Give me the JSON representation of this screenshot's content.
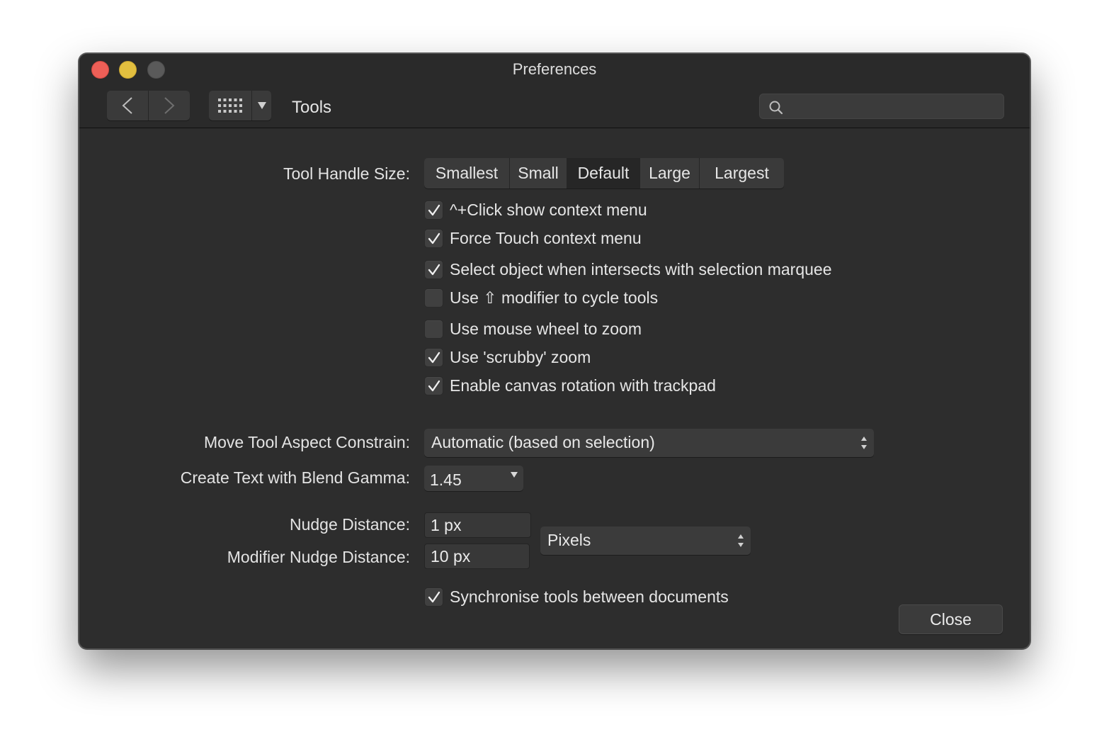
{
  "window": {
    "title": "Preferences"
  },
  "toolbar": {
    "section_title": "Tools",
    "search_placeholder": ""
  },
  "tool_handle_size": {
    "label": "Tool Handle Size:",
    "options": [
      "Smallest",
      "Small",
      "Default",
      "Large",
      "Largest"
    ],
    "selected": "Default"
  },
  "checkboxes": [
    {
      "label": "^+Click show context menu",
      "checked": true
    },
    {
      "label": "Force Touch context menu",
      "checked": true
    },
    {
      "label": "Select object when intersects with selection marquee",
      "checked": true
    },
    {
      "label": "Use ⇧ modifier to cycle tools",
      "checked": false
    },
    {
      "label": "Use mouse wheel to zoom",
      "checked": false
    },
    {
      "label": "Use 'scrubby' zoom",
      "checked": true
    },
    {
      "label": "Enable canvas rotation with trackpad",
      "checked": true
    }
  ],
  "move_tool": {
    "label": "Move Tool Aspect Constrain:",
    "value": "Automatic (based on selection)"
  },
  "blend_gamma": {
    "label": "Create Text with Blend Gamma:",
    "value": "1.45"
  },
  "nudge": {
    "label": "Nudge Distance:",
    "value": "1 px"
  },
  "modifier_nudge": {
    "label": "Modifier Nudge Distance:",
    "value": "10 px"
  },
  "units": {
    "value": "Pixels"
  },
  "sync": {
    "label": "Synchronise tools between documents",
    "checked": true
  },
  "footer": {
    "close_label": "Close"
  },
  "colors": {
    "window_bg": "#2d2d2d",
    "close_light": "#ed5f57",
    "minimize_light": "#e2bf3f",
    "zoom_light_disabled": "#5a5a5a"
  }
}
